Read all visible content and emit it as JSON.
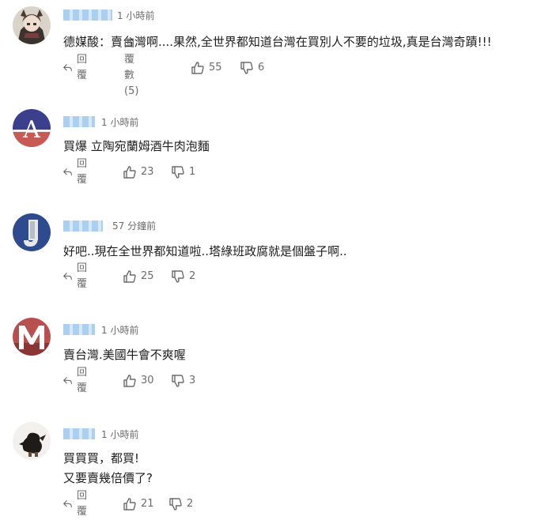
{
  "comments": [
    {
      "timestamp": "1 小時前",
      "text": "德媒酸：賣台灣啊....果然,全世界都知道台灣在買別人不要的垃圾,真是台灣奇蹟!!!",
      "reply_label": "回覆",
      "replies_label": "回覆數 (5)",
      "likes": "55",
      "dislikes": "6"
    },
    {
      "timestamp": "1 小時前",
      "text": "買爆 立陶宛蘭姆酒牛肉泡麵",
      "reply_label": "回覆",
      "likes": "23",
      "dislikes": "1"
    },
    {
      "timestamp": "57 分鐘前",
      "text": "好吧..現在全世界都知道啦..塔綠班政腐就是個盤子啊..",
      "reply_label": "回覆",
      "likes": "25",
      "dislikes": "2"
    },
    {
      "timestamp": "1 小時前",
      "text": "賣台灣.美國牛會不爽喔",
      "reply_label": "回覆",
      "likes": "30",
      "dislikes": "3"
    },
    {
      "timestamp": "1 小時前",
      "text_line1": "買買買，都買!",
      "text_line2": "又要賣幾倍價了?",
      "reply_label": "回覆",
      "likes": "21",
      "dislikes": "2"
    }
  ],
  "avatars": [
    {
      "icon": "anime-character-avatar-icon"
    },
    {
      "letter": "A",
      "color": "#3b3f8c"
    },
    {
      "letter": "J",
      "color": "#2f4b8f"
    },
    {
      "letter": "M",
      "color": "#b8504f"
    },
    {
      "icon": "black-figure-avatar-icon"
    }
  ]
}
